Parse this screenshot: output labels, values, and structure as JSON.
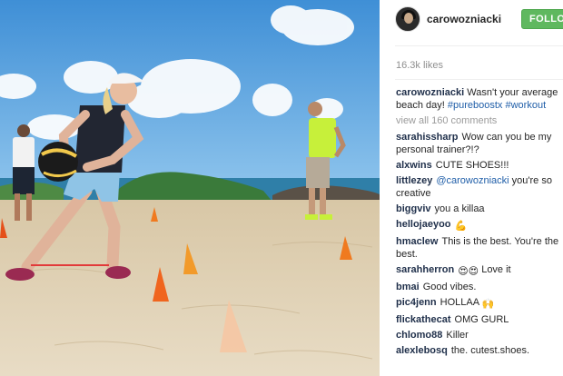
{
  "post": {
    "author": "carowozniacki",
    "follow_label": "FOLLOW",
    "likes": "16.3k likes",
    "caption": {
      "author": "carowozniacki",
      "text": "Wasn't your average beach day!",
      "hashtags": [
        "#pureboostx",
        "#workout"
      ]
    },
    "view_all_comments": "view all 160 comments"
  },
  "comments": [
    {
      "user": "sarahissharp",
      "parts": [
        {
          "t": "text",
          "v": "Wow can you be my personal trainer?!?"
        }
      ]
    },
    {
      "user": "alxwins",
      "parts": [
        {
          "t": "text",
          "v": "CUTE SHOES!!!"
        }
      ]
    },
    {
      "user": "littlezey",
      "parts": [
        {
          "t": "mention",
          "v": "@carowozniacki"
        },
        {
          "t": "text",
          "v": " you're so creative"
        }
      ]
    },
    {
      "user": "biggviv",
      "parts": [
        {
          "t": "text",
          "v": "you a killaa"
        }
      ]
    },
    {
      "user": "hellojaeyoo",
      "parts": [
        {
          "t": "emoji",
          "v": "flexed-biceps-emoji"
        }
      ]
    },
    {
      "user": "hmaclew",
      "parts": [
        {
          "t": "text",
          "v": "This is the best. You're the best."
        }
      ]
    },
    {
      "user": "sarahherron",
      "parts": [
        {
          "t": "emoji",
          "v": "heart-eyes-emoji"
        },
        {
          "t": "emoji",
          "v": "heart-eyes-emoji"
        },
        {
          "t": "text",
          "v": " Love it"
        }
      ]
    },
    {
      "user": "bmai",
      "parts": [
        {
          "t": "text",
          "v": "Good vibes."
        }
      ]
    },
    {
      "user": "pic4jenn",
      "parts": [
        {
          "t": "text",
          "v": "HOLLAA "
        },
        {
          "t": "emoji",
          "v": "raised-hands-emoji"
        }
      ]
    },
    {
      "user": "flickathecat",
      "parts": [
        {
          "t": "text",
          "v": "OMG GURL"
        }
      ]
    },
    {
      "user": "chlomo88",
      "parts": [
        {
          "t": "text",
          "v": "Killer"
        }
      ]
    },
    {
      "user": "alexlebosq",
      "parts": [
        {
          "t": "text",
          "v": "the. cutest.shoes."
        }
      ]
    }
  ],
  "colors": {
    "follow_button": "#5fb85f",
    "username": "#1f2f4a",
    "link": "#1f5ea8",
    "muted": "#8f8f8f"
  }
}
